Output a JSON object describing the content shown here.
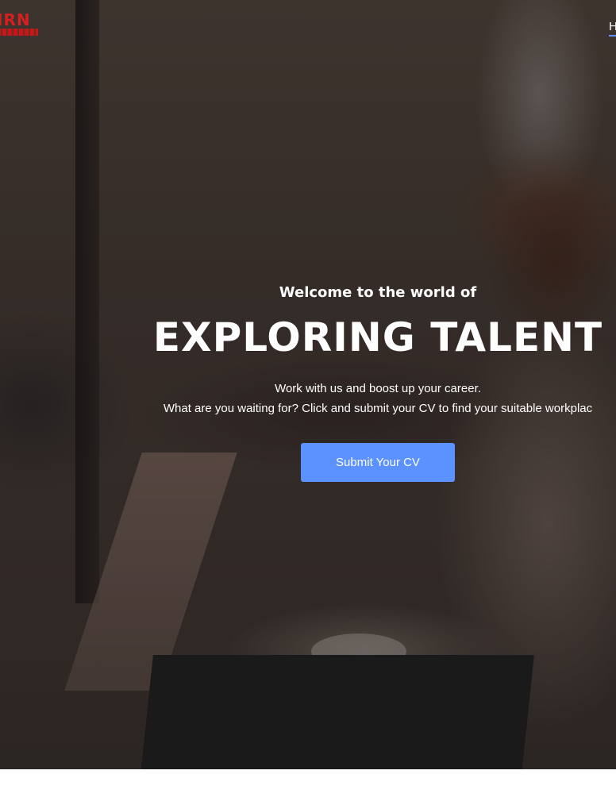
{
  "header": {
    "logo_text": "IRN",
    "nav": {
      "home_label": "H"
    }
  },
  "hero": {
    "welcome": "Welcome to the world of",
    "headline": "EXPLORING TALENT",
    "description_line1": "Work with us and boost up your career.",
    "description_line2": "What are you waiting for? Click and submit your CV to find your suitable workplac",
    "cta_label": "Submit Your CV"
  },
  "colors": {
    "accent": "#5b92ff",
    "logo_red": "#d62020",
    "text": "#ffffff"
  }
}
